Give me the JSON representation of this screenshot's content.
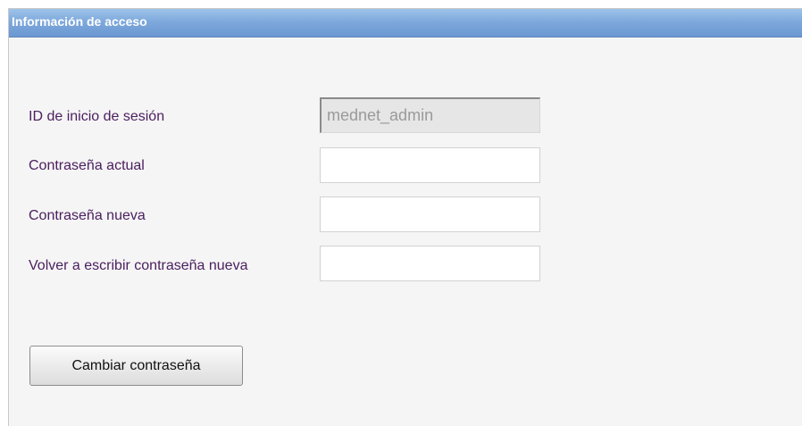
{
  "panel": {
    "title": "Información de acceso"
  },
  "form": {
    "login_id": {
      "label": "ID de inicio de sesión",
      "value": "mednet_admin"
    },
    "current_password": {
      "label": "Contraseña actual",
      "value": ""
    },
    "new_password": {
      "label": "Contraseña nueva",
      "value": ""
    },
    "confirm_password": {
      "label": "Volver a escribir contraseña nueva",
      "value": ""
    },
    "submit_label": "Cambiar contraseña"
  },
  "colors": {
    "header_blue": "#7ea9dc",
    "label_purple": "#4b2060"
  }
}
